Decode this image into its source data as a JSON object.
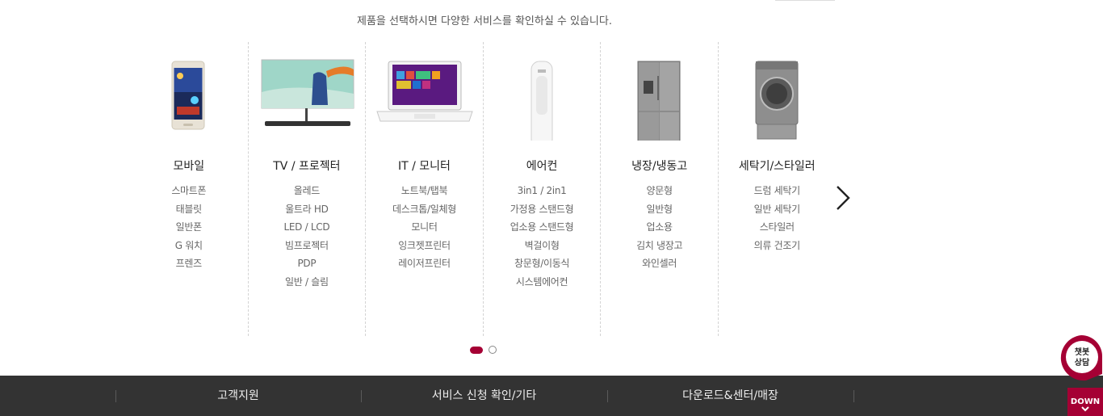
{
  "intro": {
    "text": "제품을 선택하시면 다양한 서비스를 확인하실 수 있습니다."
  },
  "categories": [
    {
      "name": "모바일",
      "items": [
        "스마트폰",
        "태블릿",
        "일반폰",
        "G 워치",
        "프렌즈"
      ]
    },
    {
      "name": "TV / 프로젝터",
      "items": [
        "올레드",
        "울트라 HD",
        "LED / LCD",
        "빔프로젝터",
        "PDP",
        "일반 / 슬림"
      ]
    },
    {
      "name": "IT / 모니터",
      "items": [
        "노트북/탭북",
        "데스크톱/일체형",
        "모니터",
        "잉크젯프린터",
        "레이저프린터"
      ]
    },
    {
      "name": "에어컨",
      "items": [
        "3in1 / 2in1",
        "가정용 스탠드형",
        "업소용 스탠드형",
        "벽걸이형",
        "창문형/이동식",
        "시스템에어컨"
      ]
    },
    {
      "name": "냉장/냉동고",
      "items": [
        "양문형",
        "일반형",
        "업소용",
        "김치 냉장고",
        "와인셀러"
      ]
    },
    {
      "name": "세탁기/스타일러",
      "items": [
        "드럼 세탁기",
        "일반 세탁기",
        "스타일러",
        "의류 건조기"
      ]
    }
  ],
  "pagination": {
    "active": 1,
    "total": 2
  },
  "footer": {
    "items": [
      "고객지원",
      "서비스 신청 확인/기타",
      "다운로드&센터/매장"
    ]
  },
  "chat": {
    "line1": "챗봇",
    "line2": "상담"
  },
  "down": {
    "label": "DOWN"
  },
  "colors": {
    "accent": "#a50034",
    "footer_bg": "#333333"
  }
}
